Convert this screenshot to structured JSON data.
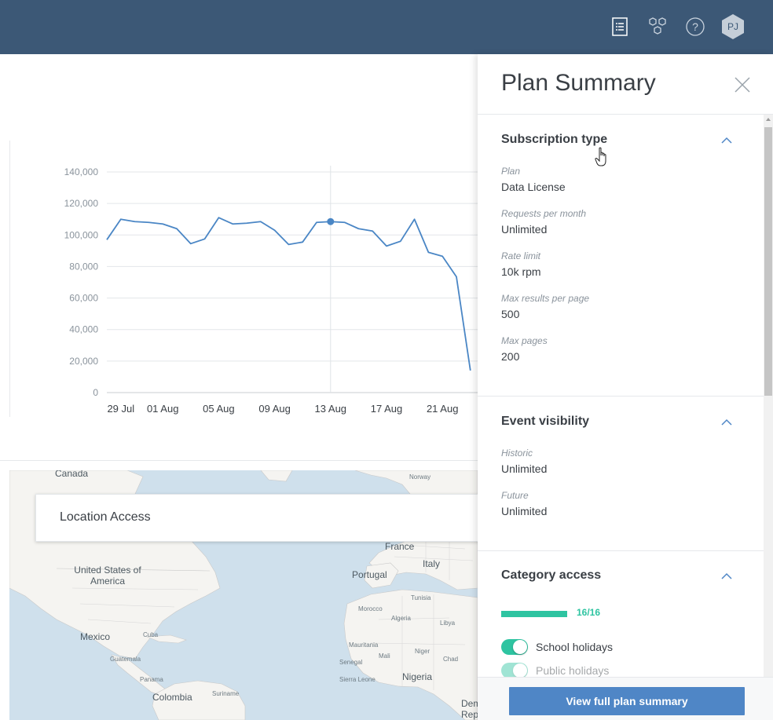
{
  "topbar": {
    "icons": [
      "list-icon",
      "hexagon-cluster-icon",
      "help-icon"
    ],
    "avatar_initials": "PJ",
    "bg_color": "#3c5876"
  },
  "chart_data": {
    "type": "line",
    "x_labels": [
      "29 Jul",
      "01 Aug",
      "05 Aug",
      "09 Aug",
      "13 Aug",
      "17 Aug",
      "21 Aug"
    ],
    "y_ticks": [
      "140,000",
      "120,000",
      "100,000",
      "80,000",
      "60,000",
      "40,000",
      "20,000",
      "0"
    ],
    "ylim": [
      0,
      140000
    ],
    "x": [
      "28 Jul",
      "29 Jul",
      "30 Jul",
      "31 Jul",
      "01 Aug",
      "02 Aug",
      "03 Aug",
      "04 Aug",
      "05 Aug",
      "06 Aug",
      "07 Aug",
      "08 Aug",
      "09 Aug",
      "10 Aug",
      "11 Aug",
      "12 Aug",
      "13 Aug",
      "14 Aug",
      "15 Aug",
      "16 Aug",
      "17 Aug",
      "18 Aug",
      "19 Aug",
      "20 Aug",
      "21 Aug",
      "22 Aug",
      "23 Aug",
      "24 Aug"
    ],
    "values": [
      97000,
      110000,
      108500,
      108000,
      107000,
      104000,
      94500,
      97500,
      111000,
      107000,
      107500,
      108500,
      103000,
      94000,
      95500,
      108000,
      108500,
      108000,
      104000,
      102500,
      93000,
      96000,
      110000,
      89000,
      86500,
      73500,
      14000
    ],
    "highlight_index": 16,
    "line_color": "#4a86c5",
    "grid": true
  },
  "main": {
    "location_access_title": "Location Access"
  },
  "map": {
    "labels": [
      "Canada",
      "United States of America",
      "Mexico",
      "Cuba",
      "Guatemala",
      "Panama",
      "Colombia",
      "Suriname",
      "Portugal",
      "France",
      "Italy",
      "Morocco",
      "Algeria",
      "Tunisia",
      "Libya",
      "Mauritania",
      "Mali",
      "Niger",
      "Chad",
      "Nigeria",
      "Senegal",
      "Sierra Leone",
      "Norway",
      "Democratic Republic"
    ]
  },
  "panel": {
    "title": "Plan Summary",
    "sections": {
      "subscription": {
        "title": "Subscription type",
        "fields": [
          {
            "label": "Plan",
            "value": "Data License"
          },
          {
            "label": "Requests per month",
            "value": "Unlimited"
          },
          {
            "label": "Rate limit",
            "value": "10k rpm"
          },
          {
            "label": "Max results per page",
            "value": "500"
          },
          {
            "label": "Max pages",
            "value": "200"
          }
        ]
      },
      "event_visibility": {
        "title": "Event visibility",
        "fields": [
          {
            "label": "Historic",
            "value": "Unlimited"
          },
          {
            "label": "Future",
            "value": "Unlimited"
          }
        ]
      },
      "category_access": {
        "title": "Category access",
        "progress_fraction": 1.0,
        "progress_text": "16/16",
        "toggles": [
          {
            "label": "School holidays",
            "on": true
          },
          {
            "label": "Public holidays",
            "on": true
          }
        ]
      }
    },
    "footer_button": "View full plan summary",
    "accent_color": "#2ec4a1",
    "button_color": "#4f86c6"
  }
}
